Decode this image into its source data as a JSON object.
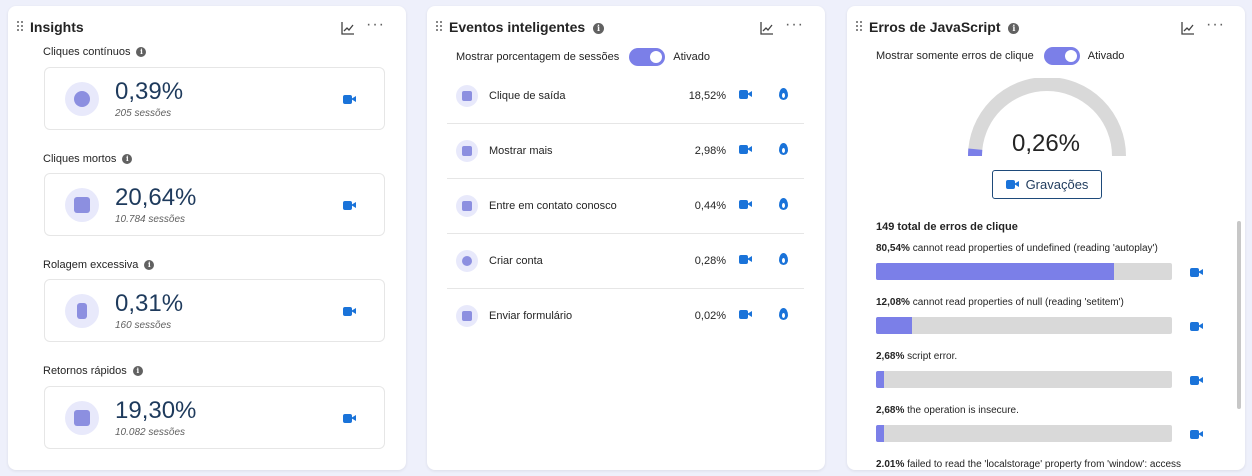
{
  "insights": {
    "title": "Insights",
    "items": [
      {
        "label": "Cliques contínuos",
        "value": "0,39%",
        "sessions": "205 sessões",
        "icon": "frustrated-face-icon"
      },
      {
        "label": "Cliques mortos",
        "value": "20,64%",
        "sessions": "10.784 sessões",
        "icon": "dead-click-cursor-icon"
      },
      {
        "label": "Rolagem excessiva",
        "value": "0,31%",
        "sessions": "160 sessões",
        "icon": "scroll-icon"
      },
      {
        "label": "Retornos rápidos",
        "value": "19,30%",
        "sessions": "10.082 sessões",
        "icon": "quick-back-icon"
      }
    ]
  },
  "events": {
    "title": "Eventos inteligentes",
    "toggle_label": "Mostrar porcentagem de sessões",
    "toggle_state": "Ativado",
    "rows": [
      {
        "label": "Clique de saída",
        "pct": "18,52%"
      },
      {
        "label": "Mostrar mais",
        "pct": "2,98%"
      },
      {
        "label": "Entre em contato conosco",
        "pct": "0,44%"
      },
      {
        "label": "Criar conta",
        "pct": "0,28%"
      },
      {
        "label": "Enviar formulário",
        "pct": "0,02%"
      }
    ]
  },
  "js_errors": {
    "title": "Erros de JavaScript",
    "toggle_label": "Mostrar somente erros de clique",
    "toggle_state": "Ativado",
    "gauge_value": "0,26%",
    "gauge_fraction": 0.0026,
    "recordings_button": "Gravações",
    "total_label": "149 total de erros de clique",
    "errors": [
      {
        "pct": "80,54%",
        "message": "cannot read properties of undefined (reading 'autoplay')",
        "fraction": 0.8054
      },
      {
        "pct": "12,08%",
        "message": "cannot read properties of null (reading 'setitem')",
        "fraction": 0.1208
      },
      {
        "pct": "2,68%",
        "message": "script error.",
        "fraction": 0.0268
      },
      {
        "pct": "2,68%",
        "message": "the operation is insecure.",
        "fraction": 0.0268
      },
      {
        "pct": "2.01%",
        "message": "failed to read the 'localstorage' property from 'window': access",
        "fraction": 0.0201
      }
    ]
  },
  "colors": {
    "accent": "#7b7fe8",
    "video": "#1a73d9",
    "value_text": "#1e3a5c",
    "bar_bg": "#d9d9d9"
  }
}
